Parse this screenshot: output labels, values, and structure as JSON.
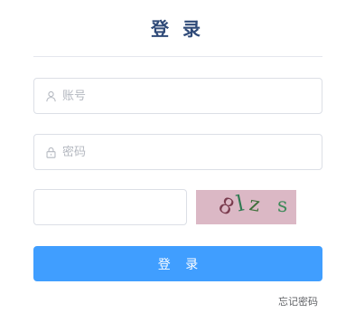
{
  "login": {
    "title": "登 录",
    "username": {
      "placeholder": "账号",
      "value": "",
      "icon": "user-icon"
    },
    "password": {
      "placeholder": "密码",
      "value": "",
      "icon": "lock-icon"
    },
    "captcha_input": {
      "placeholder": "",
      "value": ""
    },
    "captcha_image": {
      "text": "8lz s",
      "chars": [
        "8",
        "l",
        "z",
        "s"
      ],
      "background": "#dbb8c5"
    },
    "submit_label": "登 录",
    "forgot_label": "忘记密码"
  },
  "colors": {
    "title": "#2f4a78",
    "primary": "#409eff",
    "border": "#dcdfe6"
  }
}
